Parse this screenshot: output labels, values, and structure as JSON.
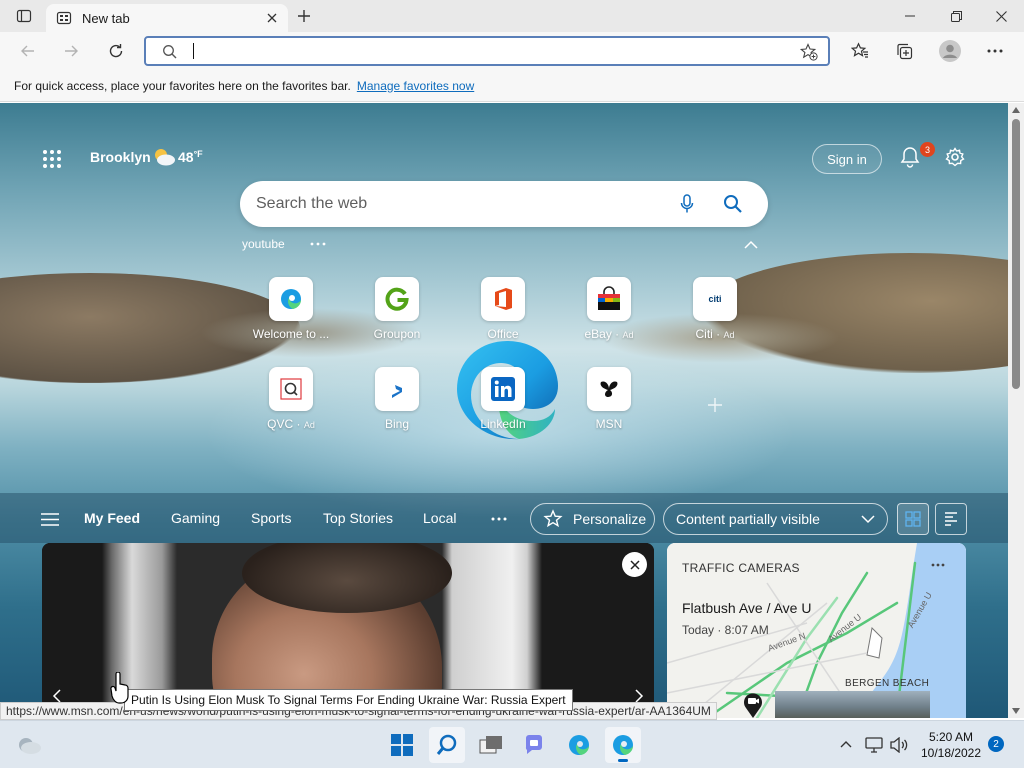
{
  "tab": {
    "title": "New tab"
  },
  "favorites_bar": {
    "message": "For quick access, place your favorites here on the favorites bar.",
    "link": "Manage favorites now"
  },
  "ntp": {
    "location": "Brooklyn",
    "temperature": "48",
    "temp_unit": "°F",
    "sign_in": "Sign in",
    "notification_count": "3",
    "search_placeholder": "Search the web",
    "recent_search": "youtube",
    "tiles": [
      {
        "label": "Welcome to ...",
        "ad": ""
      },
      {
        "label": "Groupon",
        "ad": ""
      },
      {
        "label": "Office",
        "ad": ""
      },
      {
        "label": "eBay",
        "ad": "Ad"
      },
      {
        "label": "Citi",
        "ad": "Ad"
      },
      {
        "label": "QVC",
        "ad": "Ad"
      },
      {
        "label": "Bing",
        "ad": ""
      },
      {
        "label": "LinkedIn",
        "ad": ""
      },
      {
        "label": "MSN",
        "ad": ""
      }
    ],
    "citi_logo_text": "citi"
  },
  "feed": {
    "nav": [
      "My Feed",
      "Gaming",
      "Sports",
      "Top Stories",
      "Local"
    ],
    "personalize": "Personalize",
    "content_visibility": "Content partially visible"
  },
  "traffic_card": {
    "heading": "TRAFFIC CAMERAS",
    "location": "Flatbush Ave / Ave U",
    "time": "Today · 8:07 AM",
    "map_labels": [
      "BERGEN BEACH",
      "Avenue U",
      "Avenue U",
      "Avenue N"
    ]
  },
  "tooltip": "Putin Is Using Elon Musk To Signal Terms For Ending Ukraine War: Russia Expert",
  "status_url": "https://www.msn.com/en-us/news/world/putin-is-using-elon-musk-to-signal-terms-for-ending-ukraine-war-russia-expert/ar-AA1364UM",
  "taskbar": {
    "time": "5:20 AM",
    "date": "10/18/2022",
    "notification_count": "2"
  },
  "colors": {
    "accent": "#0067c0",
    "link": "#0f6cbd",
    "badge": "#e0451e"
  }
}
